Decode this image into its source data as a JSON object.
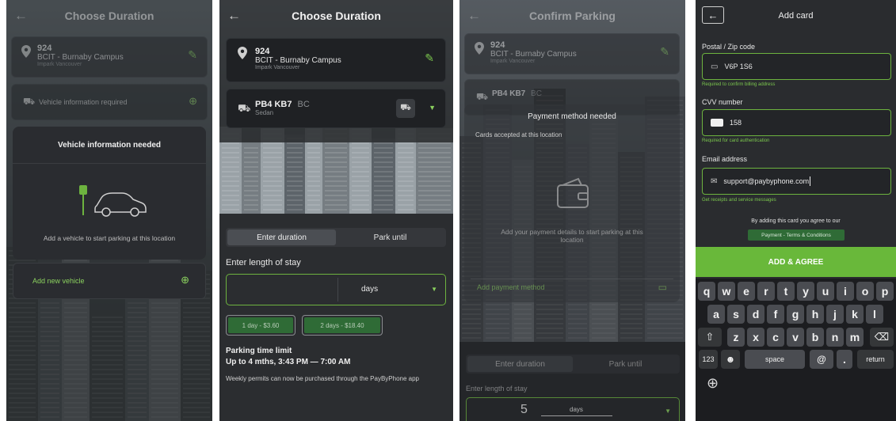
{
  "screen1": {
    "title": "Choose Duration",
    "location": {
      "id": "924",
      "name": "BCIT - Burnaby Campus",
      "operator": "Impark Vancouver"
    },
    "vehicle_required": "Vehicle information required",
    "modal": {
      "title": "Vehicle information needed",
      "body": "Add a vehicle to start parking at this location",
      "action": "Add new vehicle"
    }
  },
  "screen2": {
    "title": "Choose Duration",
    "location": {
      "id": "924",
      "name": "BCIT - Burnaby Campus",
      "operator": "Impark Vancouver"
    },
    "vehicle": {
      "plate": "PB4 KB7",
      "region": "BC",
      "type": "Sedan"
    },
    "tabs": [
      "Enter duration",
      "Park until"
    ],
    "stay_label": "Enter length of stay",
    "unit": "days",
    "chips": [
      "1 day - $3.60",
      "2 days - $18.40"
    ],
    "limit_title": "Parking time limit",
    "limit_value": "Up to 4 mths, 3:43 PM — 7:00 AM",
    "note": "Weekly permits can now be purchased through the PayByPhone app"
  },
  "screen3": {
    "title": "Confirm Parking",
    "location": {
      "id": "924",
      "name": "BCIT - Burnaby Campus",
      "operator": "Impark Vancouver"
    },
    "vehicle": {
      "plate": "PB4 KB7",
      "region": "BC"
    },
    "modal": {
      "title": "Payment method needed",
      "subtitle": "Cards accepted at this location",
      "body": "Add your payment details to start parking at this location",
      "action": "Add payment method"
    },
    "tabs": [
      "Enter duration",
      "Park until"
    ],
    "stay_label": "Enter length of stay",
    "duration_value": "5",
    "unit": "days"
  },
  "screen4": {
    "title": "Add card",
    "postal_label": "Postal / Zip code",
    "postal_value": "V6P 1S6",
    "postal_help": "Required to confirm billing address",
    "cvv_label": "CVV number",
    "cvv_value": "158",
    "cvv_help": "Required for card authentication",
    "email_label": "Email address",
    "email_value": "support@paybyphone.com",
    "email_help": "Get receipts and service messages",
    "agree_text": "By adding this card you agree to our",
    "terms_link": "Payment - Terms & Conditions",
    "add_button": "ADD & AGREE",
    "keyboard": {
      "row1": [
        "q",
        "w",
        "e",
        "r",
        "t",
        "y",
        "u",
        "i",
        "o",
        "p"
      ],
      "row2": [
        "a",
        "s",
        "d",
        "f",
        "g",
        "h",
        "j",
        "k",
        "l"
      ],
      "row3": [
        "z",
        "x",
        "c",
        "v",
        "b",
        "n",
        "m"
      ],
      "num_key": "123",
      "space_key": "space",
      "at_key": "@",
      "dot_key": ".",
      "return_key": "return"
    }
  },
  "colors": {
    "accent": "#6db33f",
    "background": "#2b2d30",
    "card": "#1f2124"
  }
}
